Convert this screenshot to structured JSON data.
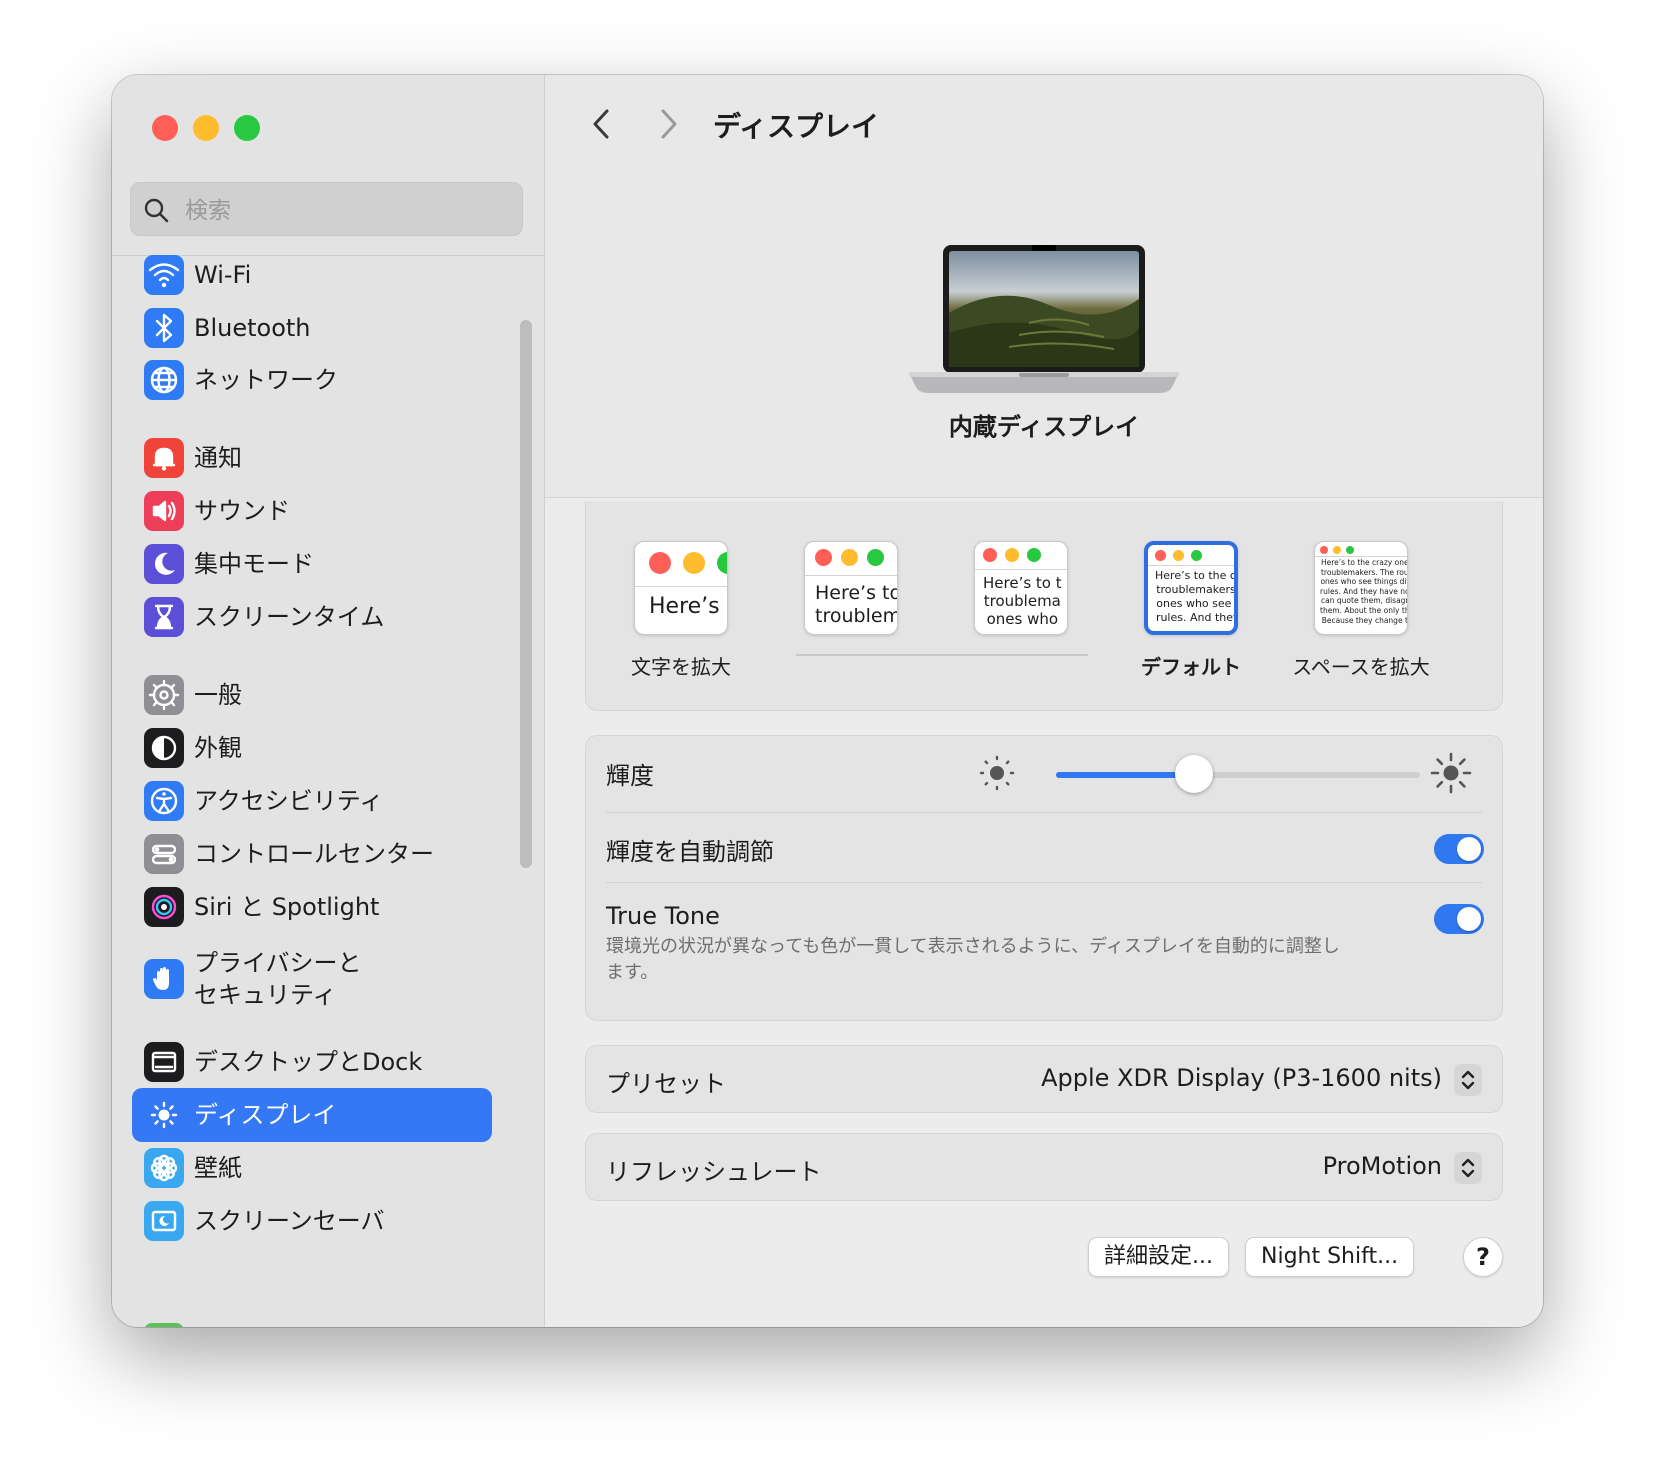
{
  "window": {
    "title": "ディスプレイ"
  },
  "colors": {
    "accent": "#3478f6",
    "close": "#ff5f57",
    "minimize": "#febc2e",
    "zoom": "#28c840",
    "toggle_on": "#2f78f0"
  },
  "sidebar": {
    "search_placeholder": "検索",
    "items": [
      {
        "label": "Wi-Fi",
        "icon": "wifi-icon",
        "color": "#2f7bf5"
      },
      {
        "label": "Bluetooth",
        "icon": "bluetooth-icon",
        "color": "#2f7bf5"
      },
      {
        "label": "ネットワーク",
        "icon": "globe-icon",
        "color": "#2f7bf5"
      },
      {
        "label": "通知",
        "icon": "bell-icon",
        "color": "#f0433a"
      },
      {
        "label": "サウンド",
        "icon": "speaker-icon",
        "color": "#ee3f5a"
      },
      {
        "label": "集中モード",
        "icon": "moon-icon",
        "color": "#5a4fd6"
      },
      {
        "label": "スクリーンタイム",
        "icon": "hourglass-icon",
        "color": "#5a4fd6"
      },
      {
        "label": "一般",
        "icon": "gear-icon",
        "color": "#8e8e93"
      },
      {
        "label": "外観",
        "icon": "appearance-icon",
        "color": "#1c1c1e"
      },
      {
        "label": "アクセシビリティ",
        "icon": "accessibility-icon",
        "color": "#2f7bf5"
      },
      {
        "label": "コントロールセンター",
        "icon": "control-center-icon",
        "color": "#8e8e93"
      },
      {
        "label": "Siri と Spotlight",
        "icon": "siri-icon",
        "color": "#1c1c1e"
      },
      {
        "label": "プライバシーと\nセキュリティ",
        "icon": "hand-icon",
        "color": "#2f7bf5"
      },
      {
        "label": "デスクトップとDock",
        "icon": "dock-icon",
        "color": "#1c1c1e"
      },
      {
        "label": "ディスプレイ",
        "icon": "display-sun-icon",
        "color": "#2f7bf5",
        "selected": true
      },
      {
        "label": "壁紙",
        "icon": "flower-icon",
        "color": "#3aa8f0"
      },
      {
        "label": "スクリーンセーバ",
        "icon": "screensaver-icon",
        "color": "#3aa8f0"
      }
    ]
  },
  "main": {
    "nav": {
      "back": "‹",
      "forward": "›"
    },
    "display_name": "内蔵ディスプレイ",
    "resolution": {
      "selected_index": 3,
      "sample_text": "Here’s to the crazy ones. The troublemakers. The ones who see things differently. They're not fond of rules. And they have no respect. You can quote them, disagree with them. About the only thing you can't do is ignore them. Because they change things.",
      "options": [
        {
          "label": "文字を拡大",
          "preview": "Here’s"
        },
        {
          "label": "",
          "preview": "Here’s to\ntroublem"
        },
        {
          "label": "",
          "preview": "Here’s to t\ntroublema\nones who"
        },
        {
          "label": "デフォルト",
          "preview": "Here’s to the cr\ntroublemakers.\nones who see t\nrules. And they"
        },
        {
          "label": "スペースを拡大",
          "preview": "Here’s to the crazy one\ntroublemakers. The rou\nones who see things dif\nrules. And they have no\ncan quote them, disagr\nthem. About the only th\nBecause they change t"
        }
      ]
    },
    "brightness": {
      "label": "輝度",
      "value": 0.38,
      "auto_label": "輝度を自動調節",
      "auto_on": true
    },
    "true_tone": {
      "label": "True Tone",
      "description": "環境光の状況が異なっても色が一貫して表示されるように、ディスプレイを自動的に調整します。",
      "on": true
    },
    "preset": {
      "label": "プリセット",
      "value": "Apple XDR Display (P3-1600 nits)"
    },
    "refresh_rate": {
      "label": "リフレッシュレート",
      "value": "ProMotion"
    },
    "buttons": {
      "advanced": "詳細設定...",
      "night_shift": "Night Shift...",
      "help": "?"
    }
  }
}
